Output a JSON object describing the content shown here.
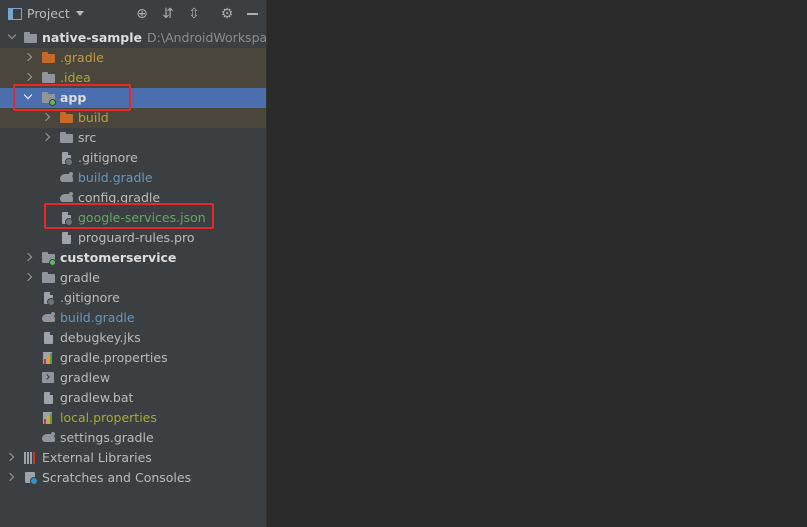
{
  "header": {
    "title": "Project",
    "icons": [
      "locate-icon",
      "expand-all-icon",
      "collapse-all-icon",
      "gear-icon",
      "hide-icon"
    ]
  },
  "tree": {
    "root": {
      "label": "native-sample",
      "path": "D:\\AndroidWorkspace\\"
    },
    "items": [
      {
        "label": ".gradle"
      },
      {
        "label": ".idea"
      },
      {
        "label": "app"
      },
      {
        "label": "build"
      },
      {
        "label": "src"
      },
      {
        "label": ".gitignore"
      },
      {
        "label": "build.gradle"
      },
      {
        "label": "config.gradle"
      },
      {
        "label": "google-services.json"
      },
      {
        "label": "proguard-rules.pro"
      },
      {
        "label": "customerservice"
      },
      {
        "label": "gradle"
      },
      {
        "label": ".gitignore"
      },
      {
        "label": "build.gradle"
      },
      {
        "label": "debugkey.jks"
      },
      {
        "label": "gradle.properties"
      },
      {
        "label": "gradlew"
      },
      {
        "label": "gradlew.bat"
      },
      {
        "label": "local.properties"
      },
      {
        "label": "settings.gradle"
      },
      {
        "label": "External Libraries"
      },
      {
        "label": "Scratches and Consoles"
      }
    ]
  },
  "colors": {
    "selection": "#4b6eaf",
    "excluded_highlight": "#4a463b",
    "annotation": "#e32a2a",
    "excluded_text": "#c59a3f",
    "modified_text": "#6897bb",
    "added_text": "#62a862"
  }
}
